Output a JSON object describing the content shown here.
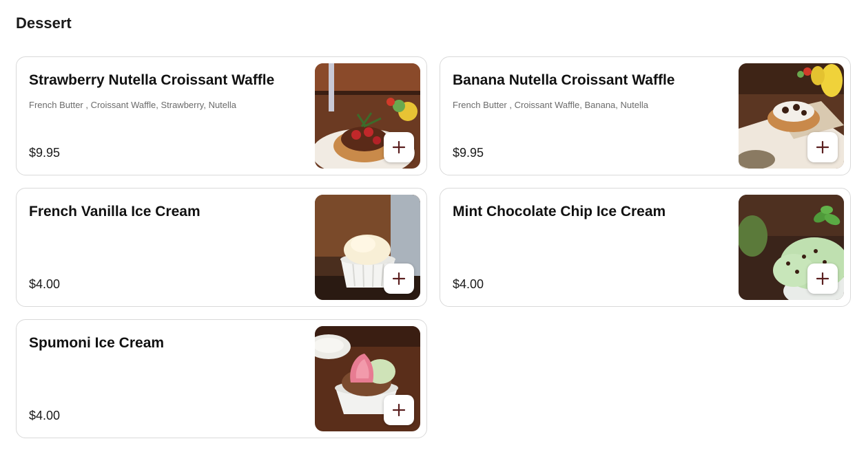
{
  "section": {
    "title": "Dessert"
  },
  "items": [
    {
      "name": "Strawberry Nutella Croissant Waffle",
      "description": "French Butter , Croissant Waffle, Strawberry, Nutella",
      "price": "$9.95",
      "image": "strawberry-nutella-waffle-photo"
    },
    {
      "name": "Banana Nutella Croissant Waffle",
      "description": "French Butter , Croissant Waffle, Banana, Nutella",
      "price": "$9.95",
      "image": "banana-nutella-waffle-photo"
    },
    {
      "name": "French Vanilla Ice Cream",
      "description": "",
      "price": "$4.00",
      "image": "vanilla-ice-cream-photo"
    },
    {
      "name": "Mint Chocolate Chip Ice Cream",
      "description": "",
      "price": "$4.00",
      "image": "mint-chip-ice-cream-photo"
    },
    {
      "name": "Spumoni Ice Cream",
      "description": "",
      "price": "$4.00",
      "image": "spumoni-ice-cream-photo"
    }
  ],
  "icons": {
    "add": "plus-icon"
  },
  "colors": {
    "add_icon": "#5a1e1e",
    "card_border": "#d9d9d9"
  }
}
